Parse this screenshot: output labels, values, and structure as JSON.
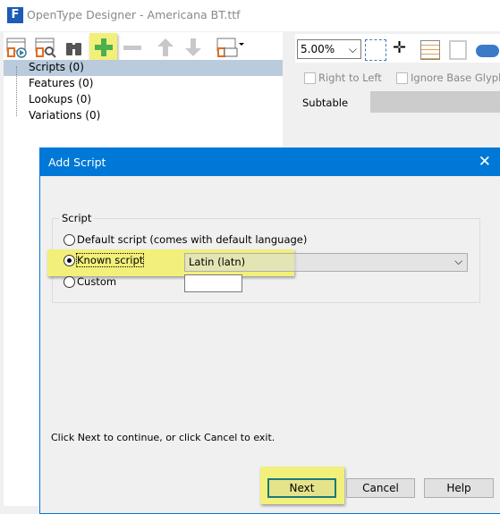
{
  "window": {
    "title": "OpenType Designer - Americana BT.ttf"
  },
  "toolbar": {
    "items": [
      "preview-icon",
      "search-icon",
      "binoculars-icon",
      "add-icon",
      "remove-icon",
      "up-arrow-icon",
      "down-arrow-icon",
      "view-options-icon"
    ]
  },
  "tree": {
    "items": [
      {
        "label": "Scripts (0)",
        "selected": true
      },
      {
        "label": "Features (0)"
      },
      {
        "label": "Lookups (0)"
      },
      {
        "label": "Variations (0)"
      }
    ]
  },
  "right": {
    "zoom": "5.00%",
    "right_to_left": "Right to Left",
    "ignore_base": "Ignore Base Glyphs",
    "subtable": "Subtable"
  },
  "dialog": {
    "title": "Add Script",
    "group": "Script",
    "options": [
      "Default script (comes with default language)",
      "Known script",
      "Custom"
    ],
    "selected": 1,
    "known_value": "Latin (latn)",
    "custom_value": "",
    "hint": "Click Next to continue, or click Cancel to exit.",
    "next": "Next",
    "cancel": "Cancel",
    "help": "Help"
  },
  "colors": {
    "accent": "#0078d7",
    "highlight": "#f2f07a",
    "add": "#4caf50"
  }
}
